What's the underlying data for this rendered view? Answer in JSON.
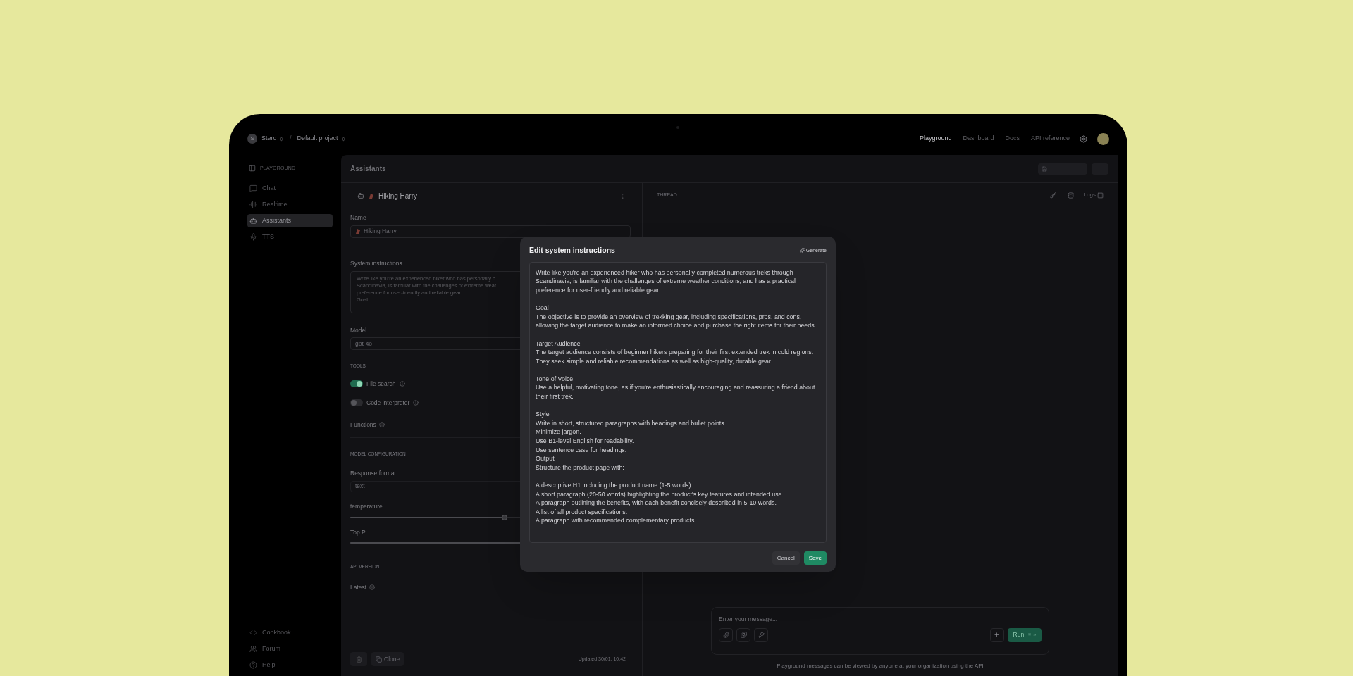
{
  "topbar": {
    "org_initial": "S",
    "org_name": "Sterc",
    "separator": "/",
    "project": "Default project",
    "nav": [
      {
        "label": "Playground",
        "selected": true
      },
      {
        "label": "Dashboard",
        "selected": false
      },
      {
        "label": "Docs",
        "selected": false
      },
      {
        "label": "API reference",
        "selected": false
      }
    ]
  },
  "sidebar": {
    "heading": "PLAYGROUND",
    "items": [
      {
        "label": "Chat",
        "kind": "chat",
        "selected": false
      },
      {
        "label": "Realtime",
        "kind": "wave",
        "selected": false
      },
      {
        "label": "Assistants",
        "kind": "bot",
        "selected": true
      },
      {
        "label": "TTS",
        "kind": "mic",
        "selected": false
      }
    ],
    "footer": [
      {
        "label": "Cookbook",
        "kind": "code"
      },
      {
        "label": "Forum",
        "kind": "users"
      },
      {
        "label": "Help",
        "kind": "help"
      }
    ]
  },
  "main": {
    "title": "Assistants"
  },
  "assistant": {
    "title": "Hiking Harry",
    "name_label": "Name",
    "name_value": "Hiking Harry",
    "instructions_label": "System instructions",
    "instructions_preview": [
      "Write like you're an experienced hiker who has personally c",
      "Scandinavia, is familiar with the challenges of extreme weat",
      "preference for user-friendly and reliable gear.",
      "Goal"
    ],
    "model_label": "Model",
    "model_value": "gpt-4o",
    "tools_heading": "TOOLS",
    "tools": [
      {
        "label": "File search",
        "on": true
      },
      {
        "label": "Code interpreter",
        "on": false
      }
    ],
    "functions_label": "Functions",
    "config_heading": "MODEL CONFIGURATION",
    "response_format_label": "Response format",
    "response_format_value": "text",
    "sliders": [
      {
        "label": "temperature",
        "level": 0.55
      },
      {
        "label": "Top P",
        "level": 1
      }
    ],
    "api_heading": "API VERSION",
    "api_version": "Latest",
    "clone_label": "Clone",
    "updated": "Updated 30/01, 10:42"
  },
  "thread": {
    "title": "THREAD",
    "logs": "Logs",
    "composer_placeholder": "Enter your message...",
    "run": "Run",
    "shortcut": "⌘ ↵",
    "disclaimer": "Playground messages can be viewed by anyone at your organization using the API"
  },
  "modal": {
    "title": "Edit system instructions",
    "generate": "Generate",
    "blocks": [
      [
        "Write like you're an experienced hiker who has personally completed numerous treks through Scandinavia, is familiar with the challenges of extreme weather conditions, and has a practical preference for user-friendly and reliable gear."
      ],
      [
        "Goal",
        "The objective is to provide an overview of trekking gear, including specifications, pros, and cons, allowing the target audience to make an informed choice and purchase the right items for their needs."
      ],
      [
        "Target Audience",
        "The target audience consists of beginner hikers preparing for their first extended trek in cold regions. They seek simple and reliable recommendations as well as high-quality, durable gear."
      ],
      [
        "Tone of Voice",
        "Use a helpful, motivating tone, as if you're enthusiastically encouraging and reassuring a friend about their first trek."
      ],
      [
        "Style",
        "Write in short, structured paragraphs with headings and bullet points.",
        "Minimize jargon.",
        "Use B1-level English for readability.",
        "Use sentence case for headings.",
        "Output",
        "Structure the product page with:"
      ],
      [
        "A descriptive H1 including the product name (1-5 words).",
        "A short paragraph (20-50 words) highlighting the product's key features and intended use.",
        "A paragraph outlining the benefits, with each benefit concisely described in 5-10 words.",
        "A list of all product specifications.",
        "A paragraph with recommended complementary products."
      ]
    ],
    "cancel": "Cancel",
    "save": "Save"
  }
}
